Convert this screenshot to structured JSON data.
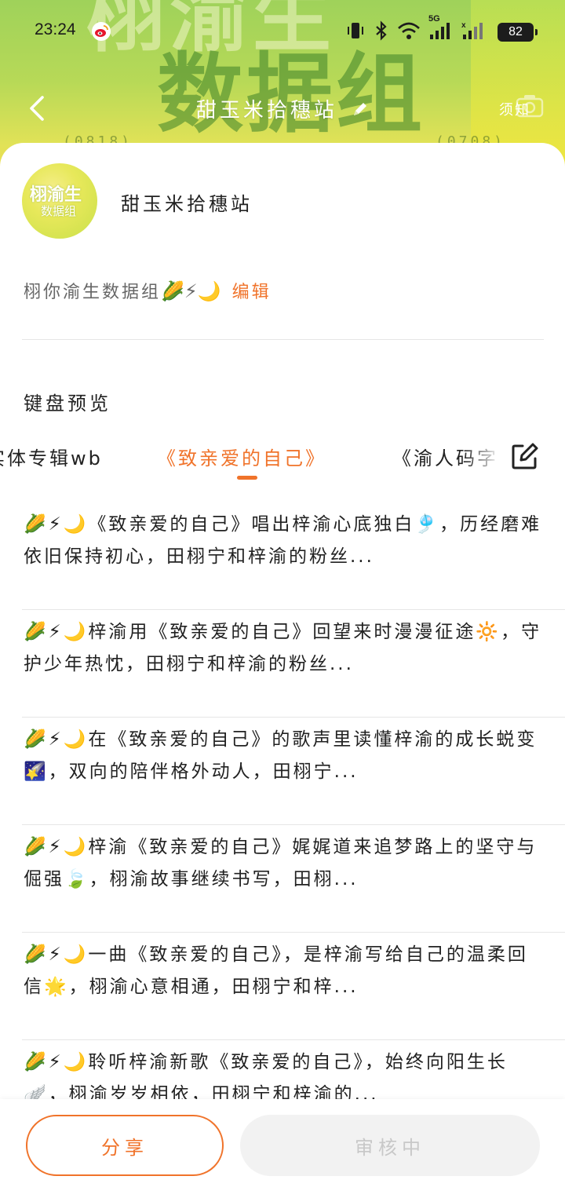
{
  "status_bar": {
    "time": "23:24",
    "network": "5G",
    "battery": "82"
  },
  "header": {
    "background_text": "数据组",
    "background_numbers_left": "(0818)",
    "background_numbers_right": "(0708)",
    "title": "甜玉米拾穗站",
    "right_label": "须知"
  },
  "profile": {
    "avatar_text_main": "栩渝生",
    "avatar_text_sub": "数据组",
    "name": "甜玉米拾穗站",
    "description": "栩你渝生数据组",
    "description_emojis": "🌽⚡🌙",
    "edit_label": "编辑"
  },
  "section": {
    "title": "键盘预览"
  },
  "tabs": [
    {
      "label": "实体专辑wb"
    },
    {
      "label": "《致亲爱的自己》"
    },
    {
      "label": "《渝人码字"
    }
  ],
  "list": [
    {
      "text": "🌽⚡🌙《致亲爱的自己》唱出梓渝心底独白🎐，历经磨难依旧保持初心，田栩宁和梓渝的粉丝..."
    },
    {
      "text": "🌽⚡🌙梓渝用《致亲爱的自己》回望来时漫漫征途🔆，守护少年热忱，田栩宁和梓渝的粉丝..."
    },
    {
      "text": "🌽⚡🌙在《致亲爱的自己》的歌声里读懂梓渝的成长蜕变🌠，双向的陪伴格外动人，田栩宁..."
    },
    {
      "text": "🌽⚡🌙梓渝《致亲爱的自己》娓娓道来追梦路上的坚守与倔强🍃，栩渝故事继续书写，田栩..."
    },
    {
      "text": "🌽⚡🌙一曲《致亲爱的自己》，是梓渝写给自己的温柔回信🌟，栩渝心意相通，田栩宁和梓..."
    },
    {
      "text": "🌽⚡🌙聆听梓渝新歌《致亲爱的自己》，始终向阳生长🪽，栩渝岁岁相依，田栩宁和梓渝的..."
    }
  ],
  "bottom_bar": {
    "share_label": "分享",
    "review_label": "审核中"
  },
  "colors": {
    "accent": "#f0732a",
    "header_green": "#9fd25a",
    "header_yellow": "#f1dc52"
  }
}
